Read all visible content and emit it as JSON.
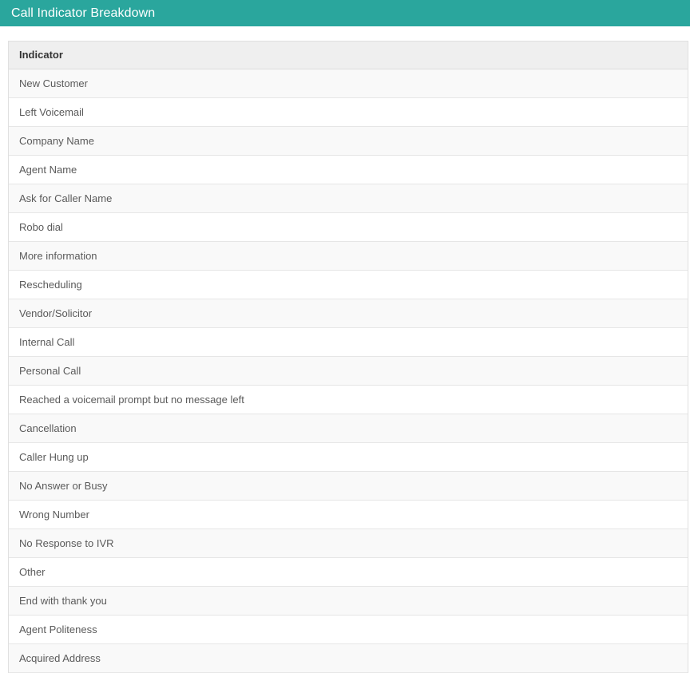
{
  "header": {
    "title": "Call Indicator Breakdown",
    "background_color": "#2aa69d",
    "text_color": "#ffffff"
  },
  "table": {
    "columns": [
      {
        "key": "indicator",
        "label": "Indicator"
      }
    ],
    "header_background_color": "#efefef",
    "row_alt_background_color": "#f9f9f9",
    "row_background_color": "#ffffff",
    "border_color": "#e0e0e0",
    "rows": [
      {
        "indicator": "New Customer"
      },
      {
        "indicator": "Left Voicemail"
      },
      {
        "indicator": "Company Name"
      },
      {
        "indicator": "Agent Name"
      },
      {
        "indicator": "Ask for Caller Name"
      },
      {
        "indicator": "Robo dial"
      },
      {
        "indicator": "More information"
      },
      {
        "indicator": "Rescheduling"
      },
      {
        "indicator": "Vendor/Solicitor"
      },
      {
        "indicator": "Internal Call"
      },
      {
        "indicator": "Personal Call"
      },
      {
        "indicator": "Reached a voicemail prompt but no message left"
      },
      {
        "indicator": "Cancellation"
      },
      {
        "indicator": "Caller Hung up"
      },
      {
        "indicator": "No Answer or Busy"
      },
      {
        "indicator": "Wrong Number"
      },
      {
        "indicator": "No Response to IVR"
      },
      {
        "indicator": "Other"
      },
      {
        "indicator": "End with thank you"
      },
      {
        "indicator": "Agent Politeness"
      },
      {
        "indicator": "Acquired Address"
      }
    ]
  }
}
